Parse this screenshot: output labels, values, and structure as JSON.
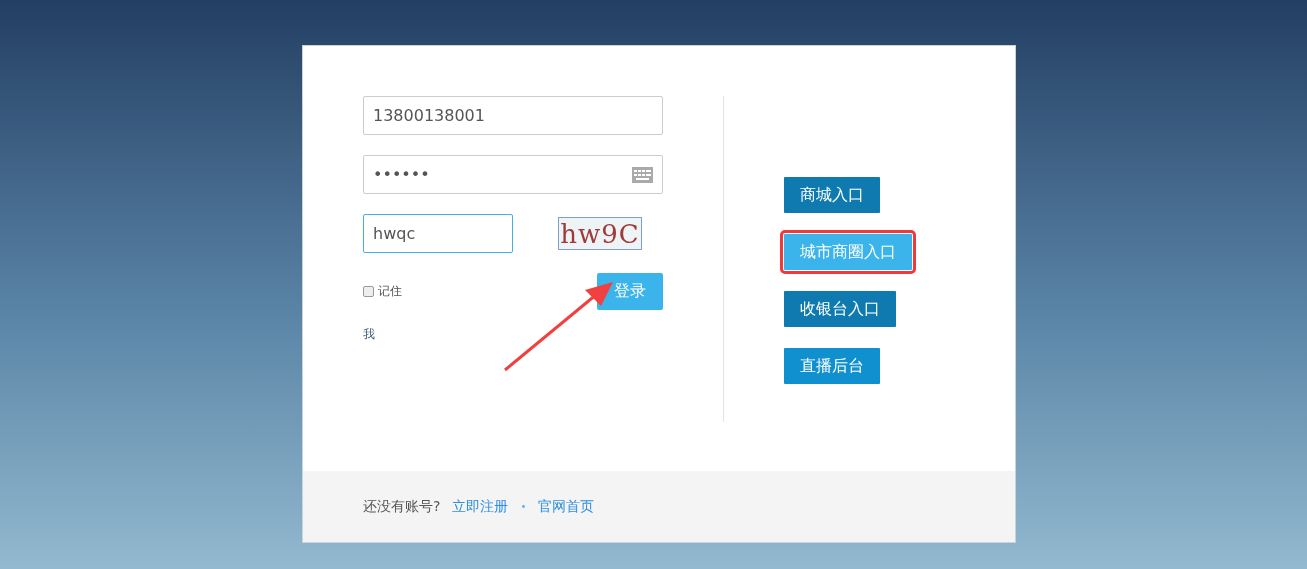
{
  "login": {
    "phone": "13800138001",
    "password": "••••••",
    "captcha_input": "hwqc",
    "captcha_image": "hw9C",
    "remember": {
      "label": "记住",
      "checked": false
    },
    "login_button": "登录",
    "link": "我"
  },
  "entries": [
    {
      "label": "商城入口",
      "color": "#0e7ab0",
      "highlighted": false
    },
    {
      "label": "城市商圈入口",
      "color": "#3bb4ec",
      "highlighted": true
    },
    {
      "label": "收银台入口",
      "color": "#0e7ab0",
      "highlighted": false
    },
    {
      "label": "直播后台",
      "color": "#1190d0",
      "highlighted": false
    }
  ],
  "footer": {
    "prompt": "还没有账号?",
    "register": "立即注册",
    "separator": "•",
    "home": "官网首页"
  },
  "annotations": [
    {
      "kind": "arrow"
    }
  ]
}
